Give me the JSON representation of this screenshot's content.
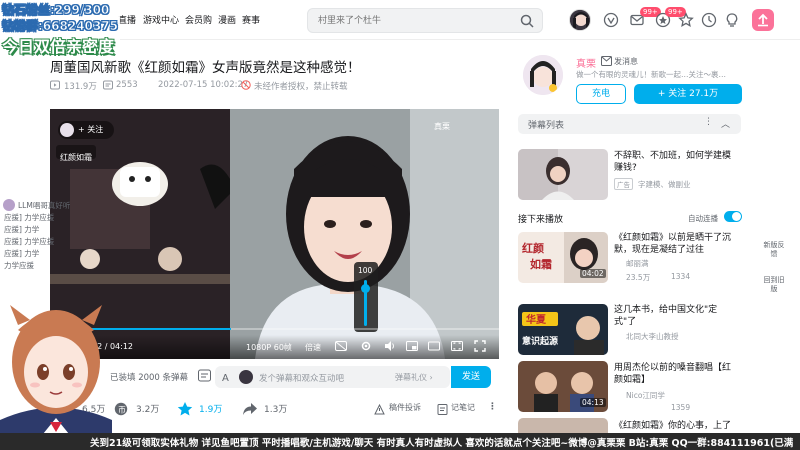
{
  "overlay": {
    "fans_line": "钻石粉丝:299/300",
    "group_line": "钻粉群:668240375",
    "promo_line": "今日双倍亲密度"
  },
  "header": {
    "nav": [
      "直播",
      "游戏中心",
      "会员购",
      "漫画",
      "赛事"
    ],
    "search_placeholder": "村里来了个杜牛",
    "badge_1": "99+",
    "badge_2": "99+"
  },
  "video": {
    "title": "周董国风新歌《红颜如霜》女声版竟然是这种感觉！",
    "views": "131.9万",
    "danmaku_count": "2553",
    "date": "2022-07-15 10:02:27",
    "notice": "未经作者授权，禁止转载"
  },
  "player": {
    "uploader_tag_follow": "+ 关注",
    "song_tag": "红颜如霜",
    "watermark": "真栗",
    "volume": "100",
    "time": "12 / 04:12",
    "quality": "1080P 60帧",
    "speed": "倍速"
  },
  "danmaku_bar": {
    "loaded": "已装填 2000 条弹幕",
    "input_placeholder": "发个弹幕和观众互动吧",
    "etiquette": "弹幕礼仪 ›",
    "send": "发送"
  },
  "actions": {
    "like_partial": "6.5万",
    "coin": "3.2万",
    "fav": "1.9万",
    "share": "1.3万",
    "report": "稿件投诉",
    "notes": "记笔记",
    "more": "⋮"
  },
  "uploader": {
    "name": "真栗",
    "message": "发消息",
    "bio": "做一个有眼的灵魂儿！新歌一起…关注～裹…",
    "charge": "充电",
    "follow": "+ 关注 27.1万"
  },
  "danmaku_list": {
    "label": "弹幕列表",
    "more": "⋮",
    "toggle": "︿"
  },
  "ad_card": {
    "title": "不辞职、不加班，如何学建模赚钱?",
    "tag": "广告",
    "source": "字建模、做副业"
  },
  "next_section": {
    "label": "接下来播放",
    "autoplay": "自动连播"
  },
  "cards": [
    {
      "title": "《红颜如霜》以前是晒干了沉默，现在是凝结了过往",
      "author": "邮丽满",
      "views": "23.5万",
      "comments": "1334",
      "duration": "04:02",
      "thumb_text": "红颜如霜"
    },
    {
      "title": "这几本书，给中国文化\"定式\"了",
      "author": "北同大李山教授",
      "views": "",
      "comments": "",
      "duration": "",
      "thumb_text": "华夏 意识起源自哪?"
    },
    {
      "title": "用周杰伦以前的嗓音翻唱【红颜如霜】",
      "author": "Nico江同学",
      "views": "",
      "comments": "1359",
      "duration": "04:13",
      "thumb_text": ""
    },
    {
      "title": "《红颜如霜》你的心事，上了",
      "author": "",
      "views": "",
      "comments": "",
      "duration": "",
      "thumb_text": ""
    }
  ],
  "side_tools": {
    "feedback": "新版反馈",
    "old": "回到旧版"
  },
  "chat": {
    "user": "LLM唱哥真好听",
    "lines": [
      "应援] 力学应援",
      "应援] 力学",
      "应援] 力学应援",
      "应援] 力学",
      "力学应援"
    ]
  },
  "ticker": "关到21级可领取实体礼物 详见鱼吧置顶 平时播唱歌/主机游戏/聊天 有时真人有时虚拟人 喜欢的话就点个关注吧~微博@真栗栗 B站:真栗 QQ一群:884111961(已满"
}
